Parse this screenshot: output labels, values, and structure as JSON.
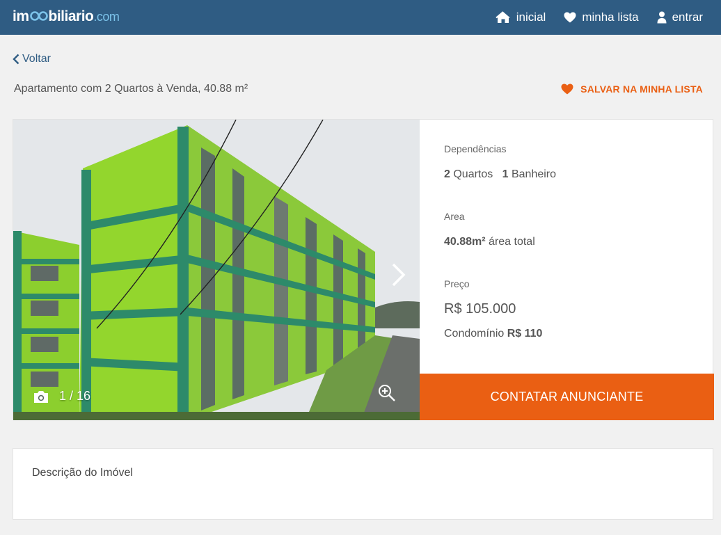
{
  "header": {
    "logo": {
      "prefix": "im",
      "suffix": "biliario",
      "domain": ".com"
    },
    "nav": [
      {
        "label": "inicial",
        "icon": "home-icon"
      },
      {
        "label": "minha lista",
        "icon": "heart-icon"
      },
      {
        "label": "entrar",
        "icon": "user-icon"
      }
    ]
  },
  "back_label": "Voltar",
  "page_title": "Apartamento com 2 Quartos à Venda, 40.88 m²",
  "save_label": "SALVAR NA MINHA LISTA",
  "gallery": {
    "counter": "1 / 16"
  },
  "details": {
    "dependencias_label": "Dependências",
    "quartos_count": "2",
    "quartos_label": "Quartos",
    "banheiros_count": "1",
    "banheiros_label": "Banheiro",
    "area_label": "Area",
    "area_value": "40.88m²",
    "area_suffix": "área total",
    "preco_label": "Preço",
    "preco_value": "R$ 105.000",
    "condominio_label": "Condomínio",
    "condominio_value": "R$ 110"
  },
  "cta_label": "CONTATAR ANUNCIANTE",
  "description_title": "Descrição do Imóvel",
  "colors": {
    "header": "#2f5c83",
    "accent": "#ea5f13",
    "background": "#f1f1f1"
  }
}
